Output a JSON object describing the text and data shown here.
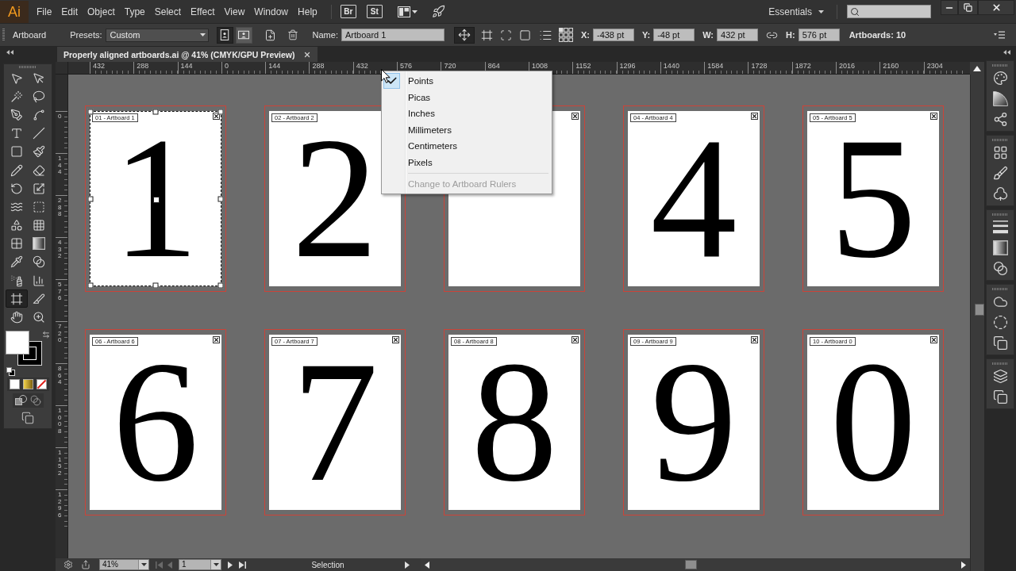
{
  "menu_bar": {
    "logo": "Ai",
    "menus": [
      "File",
      "Edit",
      "Object",
      "Type",
      "Select",
      "Effect",
      "View",
      "Window",
      "Help"
    ],
    "bridge_button": "Br",
    "stock_button": "St",
    "workspace": "Essentials"
  },
  "control_bar": {
    "panel_title": "Artboard",
    "presets_label": "Presets:",
    "preset": "Custom",
    "orientation": [
      {
        "kind": "portrait",
        "selected": true
      },
      {
        "kind": "landscape",
        "selected": false
      }
    ],
    "name_label": "Name:",
    "name": "Artboard 1",
    "move_toggle": {
      "on": true
    },
    "fields": [
      {
        "label": "X:",
        "value": "-438 pt"
      },
      {
        "label": "Y:",
        "value": "-48 pt"
      },
      {
        "label": "W:",
        "value": "432 pt"
      },
      {
        "label": "H:",
        "value": "576 pt"
      }
    ],
    "artboard_count": "Artboards: 10"
  },
  "document_tab": {
    "title": "Properly aligned artboards.ai @ 41% (CMYK/GPU Preview)"
  },
  "rulers": {
    "horizontal": [
      "432",
      "288",
      "144",
      "0",
      "144",
      "288",
      "432",
      "576",
      "720",
      "864",
      "1008",
      "1152",
      "1296",
      "1440",
      "1584",
      "1728",
      "1872",
      "2016",
      "2160",
      "2304"
    ],
    "vertical": [
      "0",
      "144",
      "288",
      "432",
      "576",
      "720",
      "864",
      "1008",
      "1152",
      "1296"
    ]
  },
  "tools": [
    {
      "kind": "selection",
      "selected": false
    },
    {
      "kind": "direct_selection",
      "selected": false
    },
    {
      "kind": "magic_wand",
      "selected": false
    },
    {
      "kind": "lasso",
      "selected": false
    },
    {
      "kind": "pen",
      "selected": false
    },
    {
      "kind": "curvature",
      "selected": false
    },
    {
      "kind": "type",
      "selected": false
    },
    {
      "kind": "line",
      "selected": false
    },
    {
      "kind": "rectangle",
      "selected": false
    },
    {
      "kind": "paintbrush",
      "selected": false
    },
    {
      "kind": "pencil",
      "selected": false
    },
    {
      "kind": "eraser",
      "selected": false
    },
    {
      "kind": "rotate",
      "selected": false
    },
    {
      "kind": "scale",
      "selected": false
    },
    {
      "kind": "warp",
      "selected": false
    },
    {
      "kind": "free_transform",
      "selected": false
    },
    {
      "kind": "shape_builder",
      "selected": false
    },
    {
      "kind": "perspective_grid",
      "selected": false
    },
    {
      "kind": "mesh",
      "selected": false
    },
    {
      "kind": "gradient",
      "selected": false
    },
    {
      "kind": "eyedropper",
      "selected": false
    },
    {
      "kind": "blend",
      "selected": false
    },
    {
      "kind": "symbol_sprayer",
      "selected": false
    },
    {
      "kind": "column_graph",
      "selected": false
    },
    {
      "kind": "artboard",
      "selected": true
    },
    {
      "kind": "slice",
      "selected": false
    },
    {
      "kind": "hand",
      "selected": false
    },
    {
      "kind": "zoom",
      "selected": false
    }
  ],
  "artboards": [
    {
      "label": "01 - Artboard 1",
      "numeral": "1",
      "selected": true
    },
    {
      "label": "02 - Artboard 2",
      "numeral": "2",
      "selected": false
    },
    {
      "selected": false
    },
    {
      "label": "04 - Artboard 4",
      "numeral": "4",
      "selected": false
    },
    {
      "label": "05 - Artboard 5",
      "numeral": "5",
      "selected": false
    },
    {
      "label": "06 - Artboard 6",
      "numeral": "6",
      "selected": false
    },
    {
      "label": "07 - Artboard 7",
      "numeral": "7",
      "selected": false
    },
    {
      "label": "08 - Artboard 8",
      "numeral": "8",
      "selected": false
    },
    {
      "label": "09 - Artboard 9",
      "numeral": "9",
      "selected": false
    },
    {
      "label": "10 - Artboard 0",
      "numeral": "0",
      "selected": false
    }
  ],
  "ruler_units_menu": {
    "items": [
      {
        "label": "Points",
        "checked": true
      },
      {
        "label": "Picas",
        "checked": false
      },
      {
        "label": "Inches",
        "checked": false
      },
      {
        "label": "Millimeters",
        "checked": false
      },
      {
        "label": "Centimeters",
        "checked": false
      },
      {
        "label": "Pixels",
        "checked": false
      }
    ],
    "footer": {
      "label": "Change to Artboard Rulers",
      "disabled": true
    }
  },
  "status_bar": {
    "zoom": "41%",
    "nav_buttons": [
      {
        "kind": "first",
        "disabled": true
      },
      {
        "kind": "previous",
        "disabled": true
      },
      {
        "kind": "next",
        "disabled": false
      },
      {
        "kind": "last",
        "disabled": false
      }
    ],
    "artboard_number": "1",
    "tool": "Selection"
  }
}
